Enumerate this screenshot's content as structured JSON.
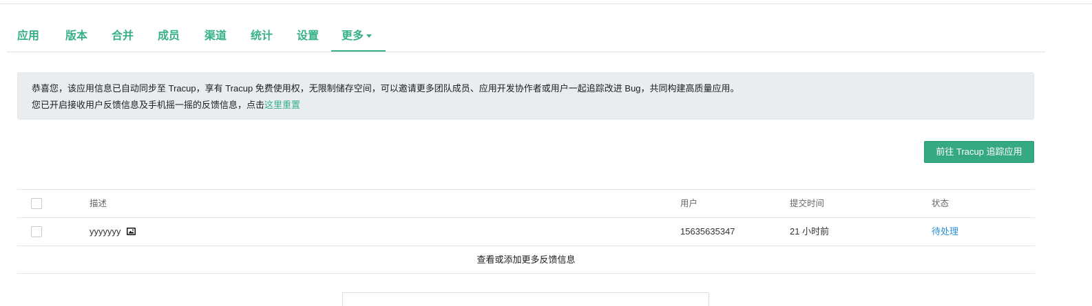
{
  "tabs": [
    {
      "label": "应用"
    },
    {
      "label": "版本"
    },
    {
      "label": "合并"
    },
    {
      "label": "成员"
    },
    {
      "label": "渠道"
    },
    {
      "label": "统计"
    },
    {
      "label": "设置"
    },
    {
      "label": "更多"
    }
  ],
  "active_tab": "更多",
  "notice": {
    "line1": "恭喜您，该应用信息已自动同步至 Tracup，享有 Tracup 免费使用权，无限制储存空间，可以邀请更多团队成员、应用开发协作者或用户一起追踪改进 Bug，共同构建高质量应用。",
    "line2_prefix": "您已开启接收用户反馈信息及手机摇一摇的反馈信息，点击",
    "line2_link": "这里重置"
  },
  "primary_button": {
    "label": "前往 Tracup 追踪应用"
  },
  "table": {
    "headers": {
      "desc": "描述",
      "user": "用户",
      "time": "提交时间",
      "status": "状态"
    },
    "rows": [
      {
        "desc": "yyyyyyy",
        "user": "15635635347",
        "time": "21 小时前",
        "status": "待处理"
      }
    ],
    "more_link": "查看或添加更多反馈信息"
  },
  "colors": {
    "accent": "#35b087",
    "button": "#35a97f",
    "status_link": "#2a8fd6",
    "notice_bg": "#e9edf0"
  },
  "icons": {
    "dropdown": "caret-down-icon",
    "attachment": "image-icon"
  }
}
